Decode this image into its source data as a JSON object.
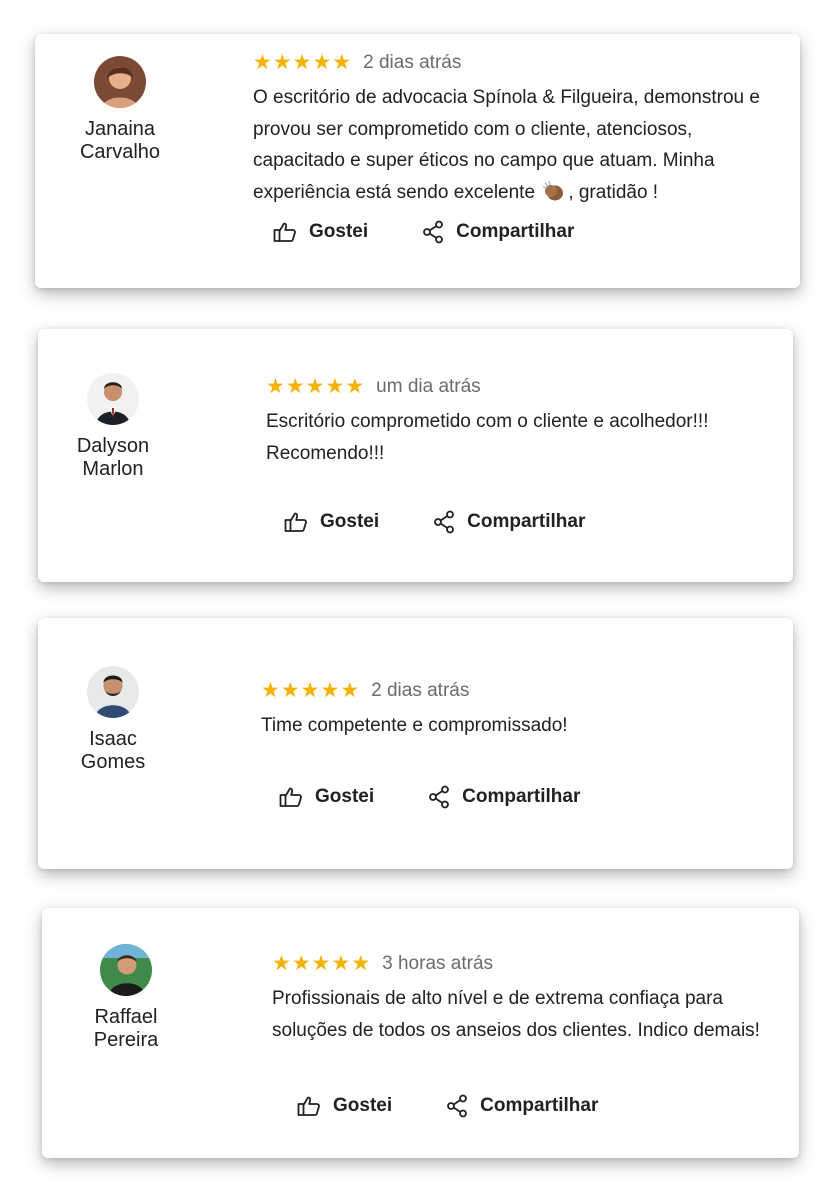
{
  "reviews": [
    {
      "name": "Janaina\nCarvalho",
      "time": "2 dias atrás",
      "text_before": "O escritório de advocacia Spínola & Filgueira, demonstrou e provou ser comprometido com o cliente, atenciosos, capacitado e super éticos no campo que atuam. Minha experiência está sendo excelente",
      "emoji": "clapping-hands-emoji",
      "text_after": ", gratidão !",
      "like_label": "Gostei",
      "share_label": "Compartilhar"
    },
    {
      "name": "Dalyson\nMarlon",
      "time": "um dia atrás",
      "text": "Escritório comprometido com o cliente e acolhedor!!! Recomendo!!!",
      "like_label": "Gostei",
      "share_label": "Compartilhar"
    },
    {
      "name": "Isaac\nGomes",
      "time": "2 dias atrás",
      "text": "Time competente e compromissado!",
      "like_label": "Gostei",
      "share_label": "Compartilhar"
    },
    {
      "name": "Raffael\nPereira",
      "time": "3 horas atrás",
      "text": "Profissionais de alto nível e de extrema confiaça para soluções de todos os anseios dos clientes. Indico demais!",
      "like_label": "Gostei",
      "share_label": "Compartilhar"
    }
  ],
  "rating": {
    "stars": 5,
    "max": 5
  },
  "colors": {
    "star": "#f6b200",
    "muted": "#6b6b6b",
    "text": "#202124"
  },
  "icons": {
    "like": "thumbs-up-icon",
    "share": "share-icon",
    "star": "star-icon"
  }
}
